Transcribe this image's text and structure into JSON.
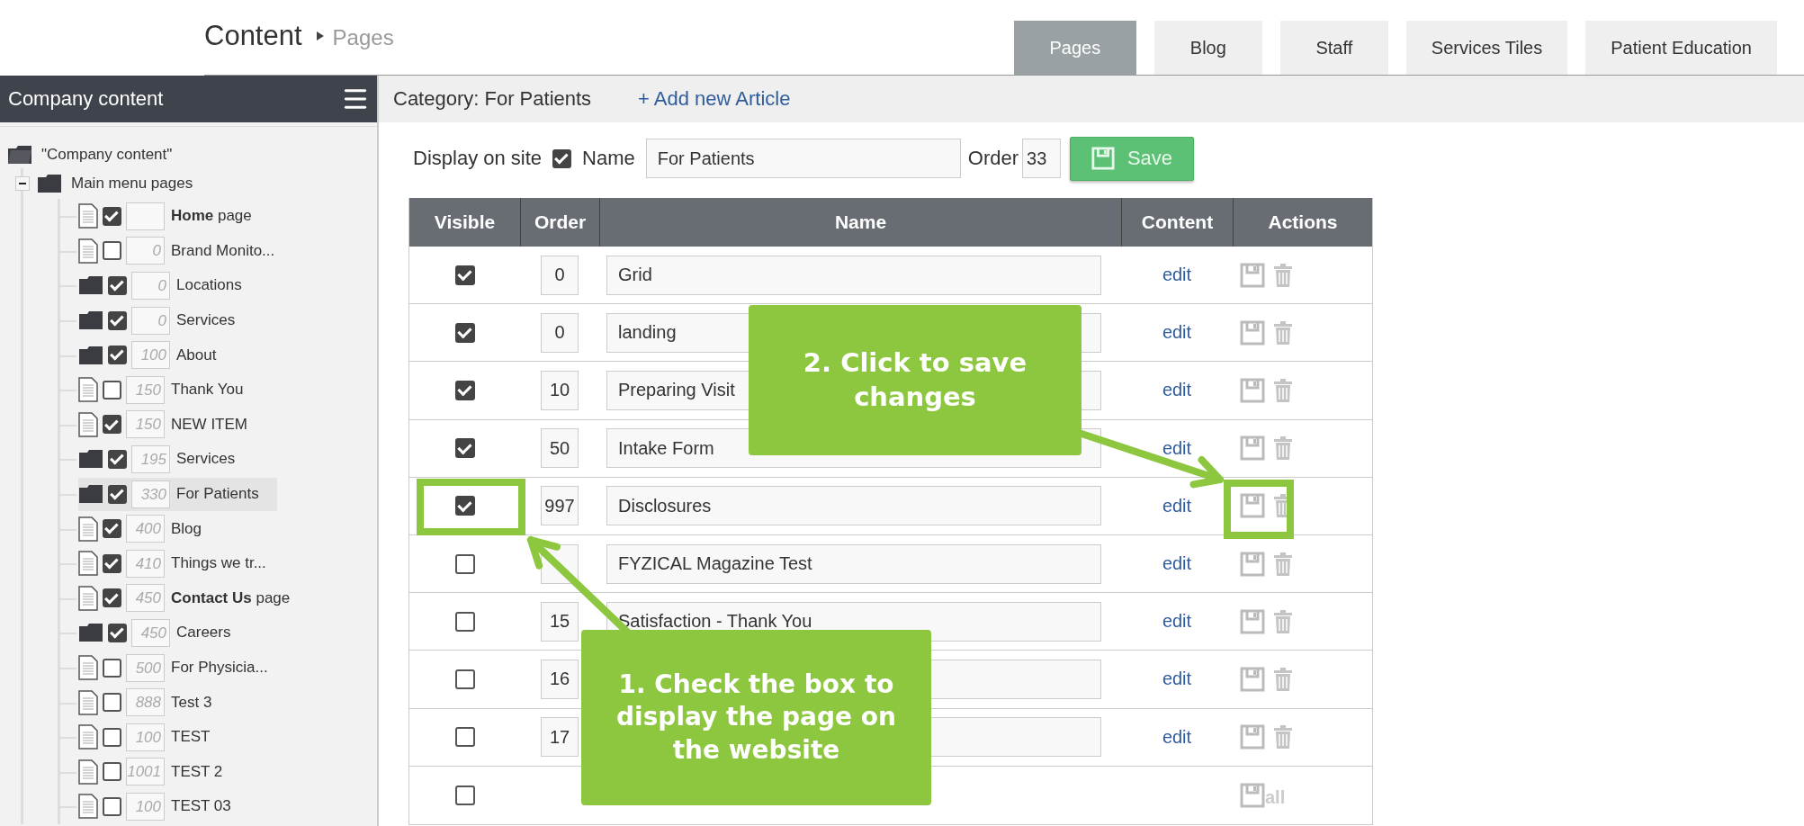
{
  "header": {
    "title": "Content",
    "breadcrumb": "Pages"
  },
  "tabs": [
    {
      "label": "Pages",
      "selected": true
    },
    {
      "label": "Blog",
      "selected": false
    },
    {
      "label": "Staff",
      "selected": false
    },
    {
      "label": "Services Tiles",
      "selected": false
    },
    {
      "label": "Patient Education",
      "selected": false
    }
  ],
  "sidebar": {
    "title": "Company content",
    "tree": {
      "label": "\"Company content\"",
      "children": [
        {
          "label": "Main menu pages",
          "expanded": true,
          "children": [
            {
              "kind": "page",
              "checked": true,
              "label": "**Home** page",
              "selected": false
            },
            {
              "kind": "page",
              "checked": false,
              "order": "0",
              "label": "Brand Monito...",
              "selected": false
            },
            {
              "kind": "folder",
              "checked": true,
              "order": "0",
              "label": "Locations",
              "selected": false
            },
            {
              "kind": "folder",
              "checked": true,
              "order": "0",
              "label": "Services",
              "selected": false
            },
            {
              "kind": "folder",
              "checked": true,
              "order": "100",
              "label": "About",
              "selected": false
            },
            {
              "kind": "page",
              "checked": false,
              "order": "150",
              "label": "Thank You",
              "selected": false
            },
            {
              "kind": "page",
              "checked": true,
              "order": "150",
              "label": "NEW ITEM",
              "selected": false
            },
            {
              "kind": "folder",
              "checked": true,
              "order": "195",
              "label": "Services",
              "selected": false
            },
            {
              "kind": "folder",
              "checked": true,
              "order": "330",
              "label": "For Patients",
              "selected": true
            },
            {
              "kind": "page",
              "checked": true,
              "order": "400",
              "label": "Blog",
              "selected": false
            },
            {
              "kind": "page",
              "checked": true,
              "order": "410",
              "label": "Things we tr...",
              "selected": false
            },
            {
              "kind": "page",
              "checked": true,
              "order": "450",
              "label": "**Contact Us** page",
              "selected": false
            },
            {
              "kind": "folder",
              "checked": true,
              "order": "450",
              "label": "Careers",
              "selected": false
            },
            {
              "kind": "page",
              "checked": false,
              "order": "500",
              "label": "For Physicia...",
              "selected": false
            },
            {
              "kind": "page",
              "checked": false,
              "order": "888",
              "label": "Test 3",
              "selected": false
            },
            {
              "kind": "page",
              "checked": false,
              "order": "100",
              "label": "TEST",
              "selected": false
            },
            {
              "kind": "page",
              "checked": false,
              "order": "1001",
              "label": "TEST 2",
              "selected": false
            },
            {
              "kind": "page",
              "checked": false,
              "order": "100",
              "label": "TEST 03",
              "selected": false
            }
          ]
        }
      ]
    }
  },
  "category": {
    "label": "Category: For Patients",
    "add_link": "+ Add new Article"
  },
  "form": {
    "display_label": "Display on site",
    "display_checked": true,
    "name_label": "Name",
    "name_value": "For Patients",
    "order_label": "Order",
    "order_value": "33",
    "save": "Save"
  },
  "table": {
    "columns": [
      "Visible",
      "Order",
      "Name",
      "Content",
      "Actions"
    ],
    "rows": [
      {
        "visible": true,
        "order": "0",
        "name": "Grid",
        "content": "edit"
      },
      {
        "visible": true,
        "order": "0",
        "name": "landing",
        "content": "edit"
      },
      {
        "visible": true,
        "order": "10",
        "name": "Preparing Visit",
        "content": "edit"
      },
      {
        "visible": true,
        "order": "50",
        "name": "Intake Form",
        "content": "edit"
      },
      {
        "visible": true,
        "order": "997",
        "name": "Disclosures",
        "content": "edit"
      },
      {
        "visible": false,
        "name": "FYZICAL Magazine Test",
        "content": "edit"
      },
      {
        "visible": false,
        "order": "15",
        "name": "Satisfaction - Thank You",
        "content": "edit"
      },
      {
        "visible": false,
        "order": "16",
        "content": "edit"
      },
      {
        "visible": false,
        "order": "17",
        "content": "edit"
      }
    ],
    "footer": {
      "visible": false,
      "save_all": "all"
    }
  },
  "annotations": [
    {
      "kind": "callout",
      "text": "1. Check the box to display the page on the website"
    },
    {
      "kind": "callout",
      "text": "2. Click to save changes"
    }
  ]
}
